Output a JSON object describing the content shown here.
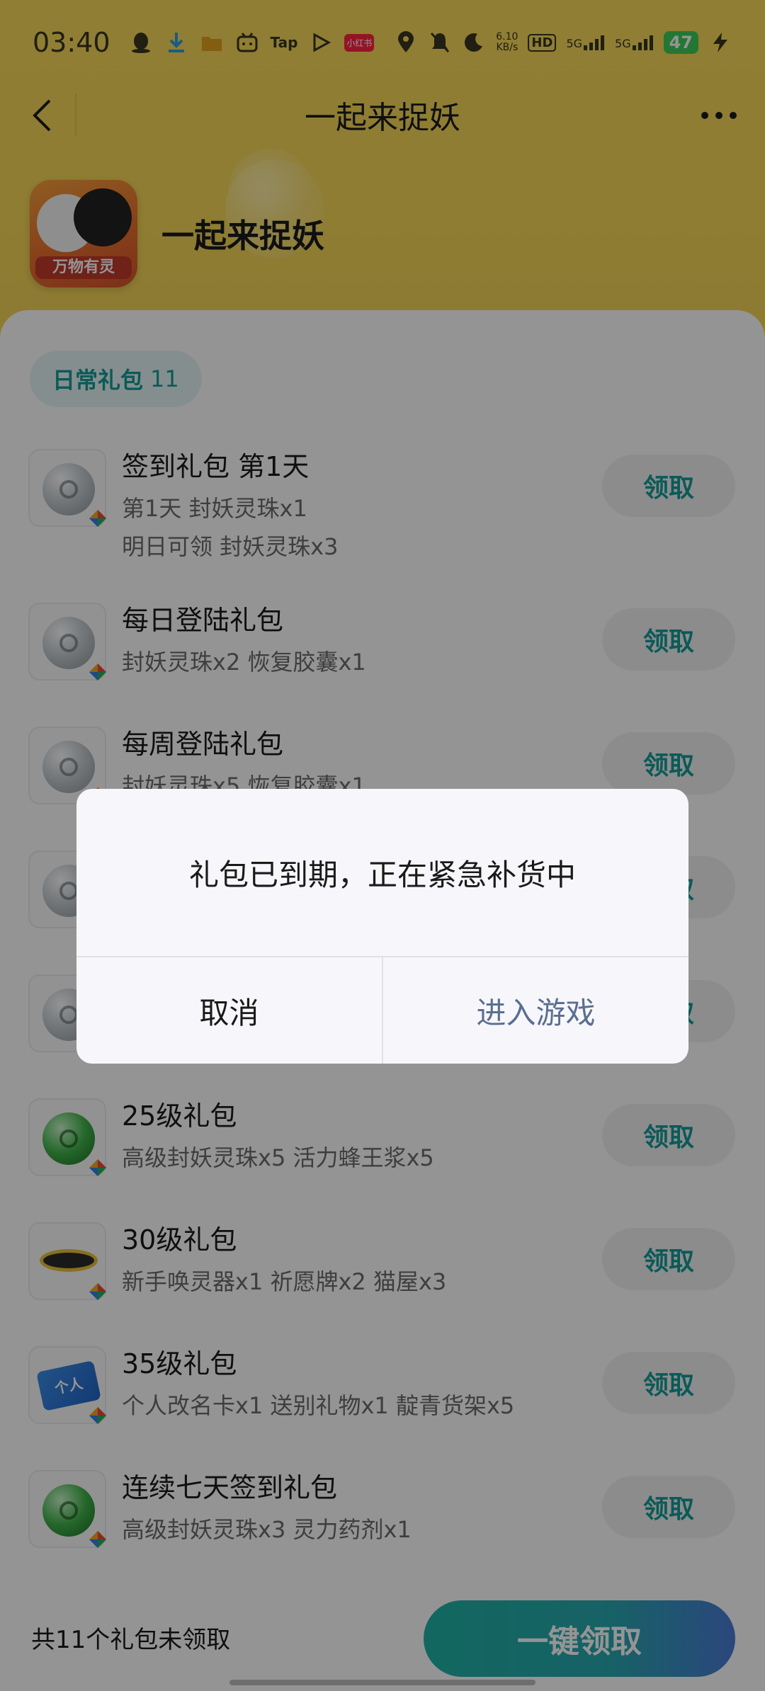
{
  "status_bar": {
    "time": "03:40",
    "net_speed": "6.10\nKB/s",
    "net_speed_top": "6.10",
    "net_speed_bottom": "KB/s",
    "hd": "HD",
    "sim1": "5G",
    "sim2": "5G",
    "battery": "47",
    "app_icons": [
      "qq-icon",
      "download-icon",
      "folder-icon",
      "bilibili-icon",
      "Tap",
      "play-icon",
      "小红书"
    ],
    "tap_label": "Tap",
    "xhs_label": "小红书"
  },
  "nav": {
    "title": "一起来捉妖"
  },
  "game": {
    "name": "一起来捉妖",
    "icon_label": "万物有灵"
  },
  "tab": {
    "label": "日常礼包",
    "count": "11"
  },
  "gifts": [
    {
      "title": "签到礼包 第1天",
      "desc": "第1天 封妖灵珠x1",
      "desc2": "明日可领 封妖灵珠x3",
      "button": "领取",
      "icon": "gray-orb"
    },
    {
      "title": "每日登陆礼包",
      "desc": "封妖灵珠x2 恢复胶囊x1",
      "button": "领取",
      "icon": "gray-orb"
    },
    {
      "title": "每周登陆礼包",
      "desc": "封妖灵珠x5 恢复胶囊x1",
      "button": "领取",
      "icon": "gray-orb"
    },
    {
      "title": "",
      "desc": "",
      "button": "领取",
      "icon": "gray-orb"
    },
    {
      "title": "",
      "desc": "",
      "button": "领取",
      "icon": "gray-orb"
    },
    {
      "title": "25级礼包",
      "desc": "高级封妖灵珠x5 活力蜂王浆x5",
      "button": "领取",
      "icon": "green-orb"
    },
    {
      "title": "30级礼包",
      "desc": "新手唤灵器x1 祈愿牌x2 猫屋x3",
      "button": "领取",
      "icon": "disc"
    },
    {
      "title": "35级礼包",
      "desc": "个人改名卡x1 送别礼物x1 靛青货架x5",
      "button": "领取",
      "icon": "card"
    },
    {
      "title": "连续七天签到礼包",
      "desc": "高级封妖灵珠x3 灵力药剂x1",
      "button": "领取",
      "icon": "green-orb"
    }
  ],
  "card_icon_text": "个人",
  "footer": {
    "summary": "共11个礼包未领取",
    "claim_all": "一键领取"
  },
  "dialog": {
    "message": "礼包已到期，正在紧急补货中",
    "cancel": "取消",
    "confirm": "进入游戏"
  },
  "colors": {
    "header_yellow": "#f6d95a",
    "accent_teal": "#149c98",
    "dialog_confirm": "#5b6f8f"
  }
}
